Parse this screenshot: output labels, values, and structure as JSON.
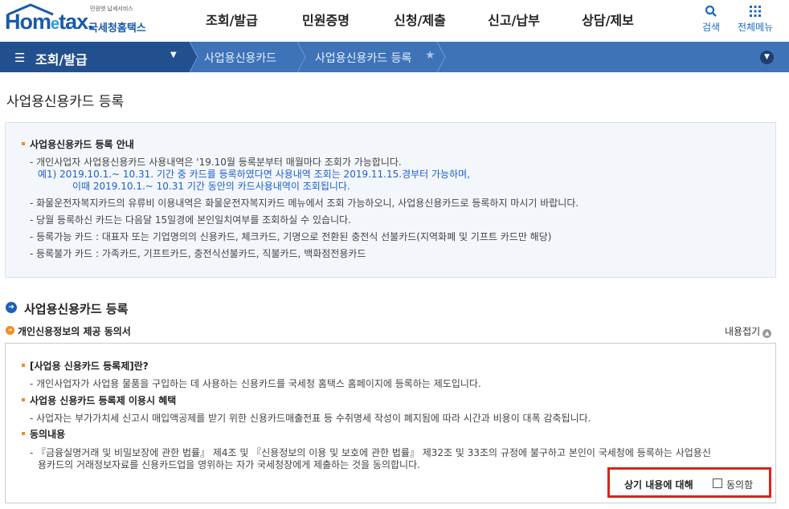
{
  "logo": {
    "tagline": "민원엣 납세서비스",
    "word_prefix": "Hom",
    "word_e": "e",
    "word_suffix": "tax.",
    "brand": "국세청홈택스"
  },
  "gnb": [
    "조회/발급",
    "민원증명",
    "신청/제출",
    "신고/납부",
    "상담/제보"
  ],
  "tools": {
    "search": "검색",
    "allmenu": "전체메뉴"
  },
  "breadcrumb": {
    "menu": "조회/발급",
    "level2": "사업용신용카드",
    "level3": "사업용신용카드 등록"
  },
  "page_title": "사업용신용카드 등록",
  "guide": {
    "heading": "사업용신용카드 등록 안내",
    "l1": "- 개인사업자 사업용신용카드 사용내역은 '19.10월 등록분부터 매월마다 조회가 가능합니다.",
    "l2": "예1) 2019.10.1.~ 10.31. 기간 중 카드를 등록하였다면 사용내역 조회는 2019.11.15.경부터 가능하며,",
    "l3": "이때 2019.10.1.~ 10.31 기간 동안의 카드사용내역이 조회됩니다.",
    "l4": "- 화물운전자복지카드의 유류비 이용내역은 화물운전자복지카드 메뉴에서 조회 가능하오니, 사업용신용카드로 등록하지 마시기 바랍니다.",
    "l5": "- 당월 등록하신 카드는 다음달 15일경에 본인일치여부를 조회하실 수 있습니다.",
    "l6": "- 등록가능 카드 : 대표자 또는 기업명의의 신용카드, 체크카드, 기명으로 전환된 충전식 선불카드(지역화폐 및 기프트 카드만 해당)",
    "l7": "- 등록불가 카드 : 가족카드, 기프트카드, 충전식선불카드, 직불카드, 백화점전용카드"
  },
  "section": {
    "title": "사업용신용카드 등록",
    "subtitle": "개인신용정보의 제공 동의서",
    "fold": "내용접기"
  },
  "consent": {
    "h1": "[사업용 신용카드 등록제]란?",
    "t1": "- 개인사업자가 사업용 물품을 구입하는 데 사용하는 신용카드를 국세청 홈택스 홈페이지에 등록하는 제도입니다.",
    "h2": "사업용 신용카드 등록제 이용시 혜택",
    "t2": "- 사업자는 부가가치세 신고시 매입액공제를 받기 위한 신용카드매출전표 등 수취명세 작성이 폐지됨에 따라 시간과 비용이 대폭 감축됩니다.",
    "h3": "동의내용",
    "t3a": "- 『금융실명거래 및 비밀보장에 관한 법률』 제4조 및 『신용정보의 이용 및 보호에 관한 법률』 제32조 및 33조의 규정에 불구하고 본인이 국세청에 등록하는 사업용신",
    "t3b": "용카드의   거래정보자료를 신용카드업을 영위하는 자가 국세청장에게 제출하는 것을 동의합니다.",
    "agree_label": "상기 내용에 대해",
    "agree_text": "동의함",
    "agree_checked": false
  },
  "colors": {
    "brand": "#1a5aa8",
    "bar": "#3f73b8",
    "bar_dark": "#22508f",
    "accent": "#f08c1e",
    "highlight": "#e02020"
  }
}
